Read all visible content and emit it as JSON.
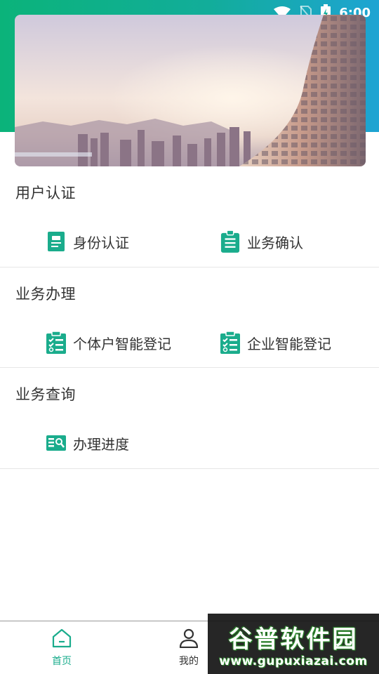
{
  "status_bar": {
    "time": "6:00",
    "icons": [
      "wifi-icon",
      "no-sim-icon",
      "battery-charging-icon"
    ]
  },
  "sections": [
    {
      "title": "用户认证",
      "items": [
        {
          "label": "身份认证",
          "icon": "id-card-icon"
        },
        {
          "label": "业务确认",
          "icon": "clipboard-list-icon"
        }
      ]
    },
    {
      "title": "业务办理",
      "items": [
        {
          "label": "个体户智能登记",
          "icon": "checklist-icon"
        },
        {
          "label": "企业智能登记",
          "icon": "checklist-icon"
        }
      ]
    },
    {
      "title": "业务查询",
      "items": [
        {
          "label": "办理进度",
          "icon": "book-search-icon"
        }
      ]
    }
  ],
  "bottom_nav": {
    "items": [
      {
        "label": "首页",
        "icon": "home-icon",
        "active": true
      },
      {
        "label": "我的",
        "icon": "user-icon",
        "active": false
      }
    ]
  },
  "watermark": {
    "title": "谷普软件园",
    "url": "www.gupuxiazai.com"
  },
  "colors": {
    "accent": "#1aac8c",
    "header_gradient": [
      "#0bb37a",
      "#1ea4d3"
    ],
    "text": "#333333",
    "divider": "#e6e6e6"
  }
}
